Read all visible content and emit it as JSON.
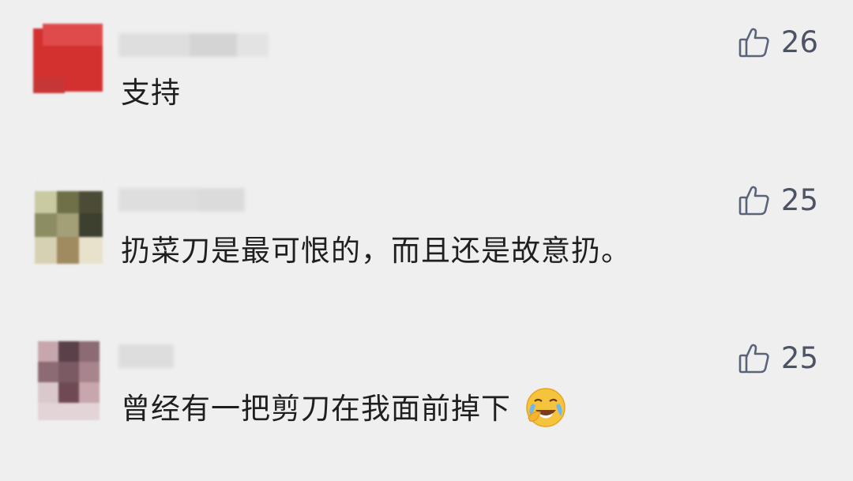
{
  "comments": [
    {
      "text": "支持",
      "likes": "26",
      "avatar_colors": [
        "#d32e2e",
        "#e84a4a",
        "#c93a3a",
        "#f2d0d0"
      ]
    },
    {
      "text": "扔菜刀是最可恨的，而且还是故意扔。",
      "likes": "25",
      "avatar_colors": [
        "#6f7048",
        "#8c8d63",
        "#3d3f2f",
        "#d7d1b4"
      ]
    },
    {
      "text": "曾经有一把剪刀在我面前掉下",
      "likes": "25",
      "emoji": "crying-laughing-emoji",
      "avatar_colors": [
        "#8d6b74",
        "#5a4048",
        "#c7a6ad",
        "#d9c9cd"
      ]
    }
  ],
  "colors": {
    "background": "#efefef",
    "text": "#1f1f1f",
    "like_icon": "#5a6478"
  },
  "icons": {
    "like": "thumbs-up-icon"
  }
}
